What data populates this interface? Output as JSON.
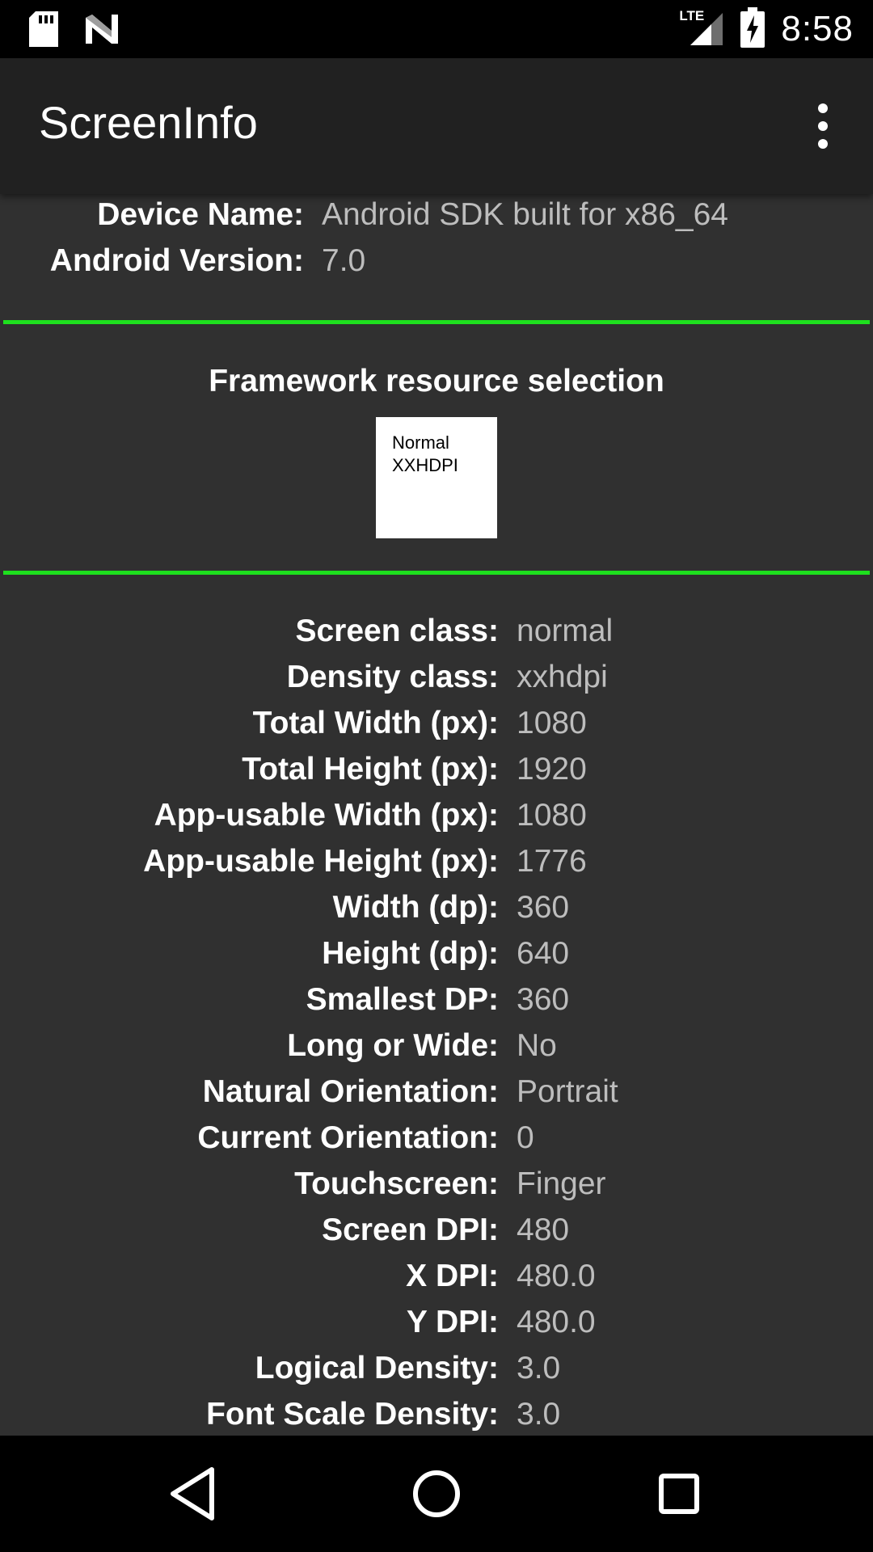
{
  "status_bar": {
    "time": "8:58",
    "network_label": "LTE",
    "icons": [
      "sd-card-icon",
      "n-logo-icon",
      "lte-signal-icon",
      "battery-charging-icon"
    ]
  },
  "app_bar": {
    "title": "ScreenInfo",
    "menu_icon": "overflow-menu-icon"
  },
  "device": {
    "rows": [
      {
        "label": "Device Name:",
        "value": "Android SDK built for x86_64"
      },
      {
        "label": "Android Version:",
        "value": "7.0"
      }
    ]
  },
  "framework": {
    "title": "Framework resource selection",
    "box_lines": [
      "Normal",
      "XXHDPI"
    ]
  },
  "metrics": {
    "rows": [
      {
        "label": "Screen class:",
        "value": "normal"
      },
      {
        "label": "Density class:",
        "value": "xxhdpi"
      },
      {
        "label": "Total Width (px):",
        "value": "1080"
      },
      {
        "label": "Total Height (px):",
        "value": "1920"
      },
      {
        "label": "App-usable Width (px):",
        "value": "1080"
      },
      {
        "label": "App-usable Height (px):",
        "value": "1776"
      },
      {
        "label": "Width (dp):",
        "value": "360"
      },
      {
        "label": "Height (dp):",
        "value": "640"
      },
      {
        "label": "Smallest DP:",
        "value": "360"
      },
      {
        "label": "Long or Wide:",
        "value": "No"
      },
      {
        "label": "Natural Orientation:",
        "value": "Portrait"
      },
      {
        "label": "Current Orientation:",
        "value": "0"
      },
      {
        "label": "Touchscreen:",
        "value": "Finger"
      },
      {
        "label": "Screen DPI:",
        "value": "480"
      },
      {
        "label": "X DPI:",
        "value": "480.0"
      },
      {
        "label": "Y DPI:",
        "value": "480.0"
      },
      {
        "label": "Logical Density:",
        "value": "3.0"
      },
      {
        "label": "Font Scale Density:",
        "value": "3.0"
      }
    ]
  },
  "colors": {
    "background": "#303030",
    "app_bar": "#212121",
    "divider": "#1ee01e",
    "value_text": "#bdbdbd"
  },
  "nav_bar": {
    "icons": [
      "back-icon",
      "home-icon",
      "recents-icon"
    ]
  }
}
